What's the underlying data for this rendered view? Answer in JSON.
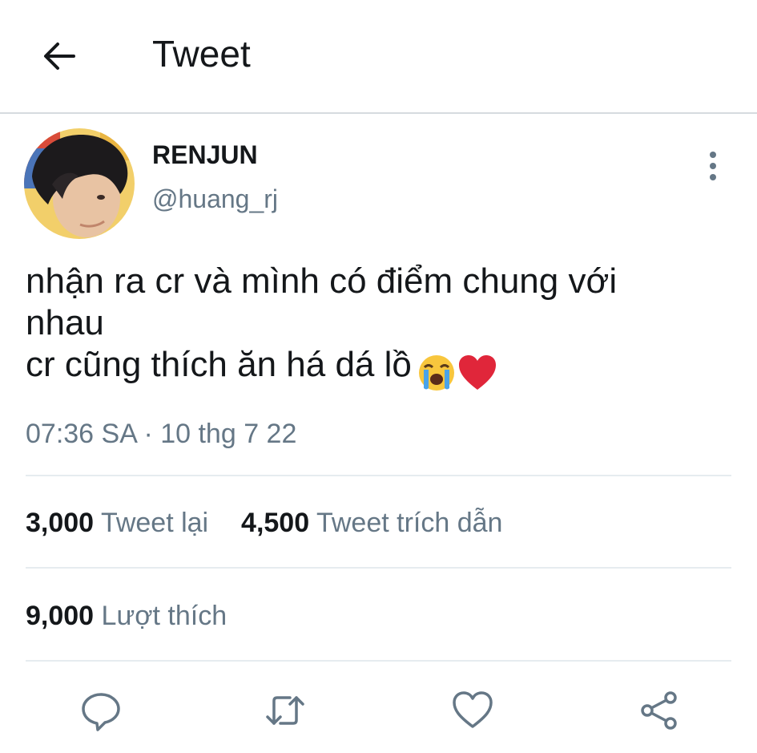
{
  "header": {
    "title": "Tweet",
    "back_icon": "arrow-left-icon"
  },
  "author": {
    "name": "RENJUN",
    "handle": "@huang_rj"
  },
  "tweet": {
    "lines": [
      "nhận ra cr và mình có điểm chung với",
      "nhau",
      "cr cũng thích ăn há dá lồ"
    ],
    "emojis": [
      "loudly-crying-face-emoji",
      "red-heart-emoji"
    ],
    "timestamp": "07:36 SA · 10 thg 7 22"
  },
  "stats": {
    "retweets": {
      "count": "3,000",
      "label": "Tweet lại"
    },
    "quotes": {
      "count": "4,500",
      "label": "Tweet trích dẫn"
    },
    "likes": {
      "count": "9,000",
      "label": "Lượt thích"
    }
  },
  "actions": [
    "reply-icon",
    "retweet-icon",
    "like-icon",
    "share-icon"
  ],
  "colors": {
    "text": "#14171a",
    "secondary": "#657786",
    "divider": "#e6ecf0",
    "heart": "#e0263a"
  }
}
